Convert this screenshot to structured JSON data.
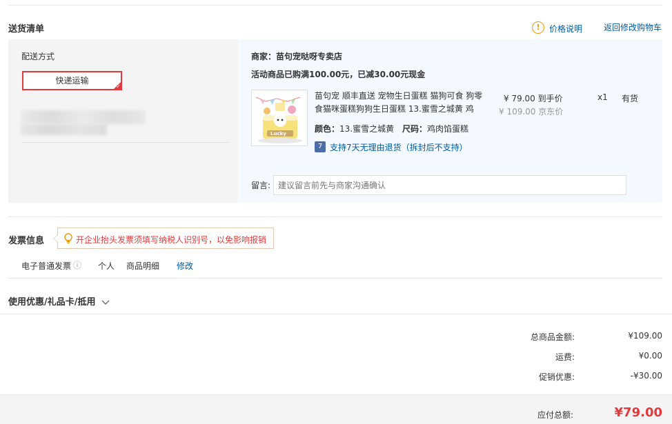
{
  "delivery": {
    "title": "送货清单",
    "price_note": "价格说明",
    "back_to_cart": "返回修改购物车",
    "method_label": "配送方式",
    "method_value": "快递运输",
    "merchant_label": "商家：",
    "merchant_name": "苗句宠哒呀专卖店",
    "promo": "活动商品已购满100.00元，已减30.00元现金",
    "product": {
      "name": "苗句宠 顺丰直送 宠物生日蛋糕 猫狗可食 狗零食猫咪蛋糕狗狗生日蛋糕 13.蜜雪之城黄 鸡",
      "price": "¥ 79.00",
      "price_tag": "到手价",
      "orig_price": "¥ 109.00",
      "orig_tag": "京东价",
      "qty": "x1",
      "stock": "有货",
      "color_label": "颜色：",
      "color_value": "13.蜜雪之城黄",
      "size_label": "尺码：",
      "size_value": "鸡肉馅蛋糕",
      "return_badge": "7",
      "return_text": "支持7天无理由退货（拆封后不支持）",
      "cake_text": "Lucky"
    },
    "message_label": "留言:",
    "message_placeholder": "建议留言前先与商家沟通确认"
  },
  "invoice": {
    "title": "发票信息",
    "tip": "开企业抬头发票须填写纳税人识别号，以免影响报销",
    "type": "电子普通发票",
    "info_icon": "ⓘ",
    "header": "个人",
    "content": "商品明细",
    "edit": "修改"
  },
  "coupon": {
    "title": "使用优惠/礼品卡/抵用"
  },
  "summary": {
    "goods_label": "总商品金额:",
    "goods_value": "¥109.00",
    "freight_label": "运费:",
    "freight_value": "¥0.00",
    "discount_label": "促销优惠:",
    "discount_value": "-¥30.00",
    "total_label": "应付总额:",
    "total_value": "¥79.00"
  },
  "colors": {
    "accent_red": "#e4393c",
    "link_blue": "#005aa0",
    "warn_orange": "#f39800"
  }
}
